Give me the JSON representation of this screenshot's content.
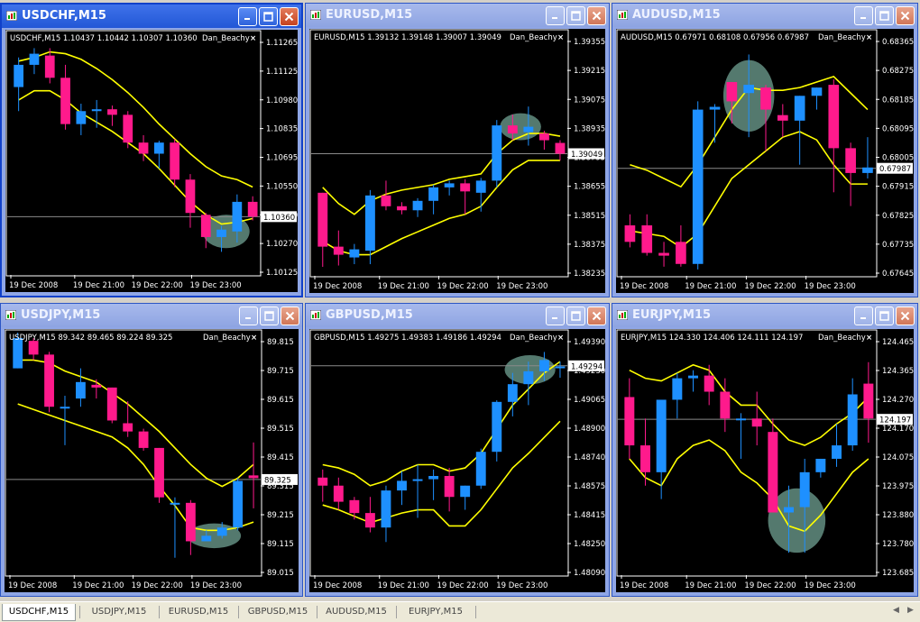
{
  "windows": [
    {
      "title": "USDCHF,M15",
      "active": true,
      "info": "USDCHF,M15  1.10437 1.10442 1.10307 1.10360",
      "ymin": 1.1005,
      "ymax": 1.1135,
      "yticks": [
        "1.11265",
        "1.11125",
        "1.10980",
        "1.10835",
        "1.10695",
        "1.10550",
        "1.10410",
        "1.10270",
        "1.10125"
      ],
      "price": 1.1036,
      "price_label": "1.10360",
      "xlabels": [
        "19 Dec 2008",
        "19 Dec 21:00",
        "19 Dec 22:00",
        "19 Dec 23:00"
      ],
      "candles": [
        [
          1.1106,
          1.1122,
          1.1093,
          1.1118
        ],
        [
          1.1118,
          1.1127,
          1.1113,
          1.1124
        ],
        [
          1.1123,
          1.1127,
          1.1108,
          1.1111
        ],
        [
          1.1111,
          1.1118,
          1.1083,
          1.1086
        ],
        [
          1.1086,
          1.1097,
          1.108,
          1.1093
        ],
        [
          1.1093,
          1.1099,
          1.1084,
          1.1094
        ],
        [
          1.1094,
          1.1096,
          1.1085,
          1.1091
        ],
        [
          1.1091,
          1.1093,
          1.1073,
          1.1076
        ],
        [
          1.1076,
          1.108,
          1.1066,
          1.107
        ],
        [
          1.107,
          1.1077,
          1.1062,
          1.1076
        ],
        [
          1.1076,
          1.1078,
          1.1052,
          1.1056
        ],
        [
          1.1056,
          1.1059,
          1.103,
          1.1038
        ],
        [
          1.1037,
          1.1038,
          1.1019,
          1.1025
        ],
        [
          1.1025,
          1.1031,
          1.1017,
          1.1029
        ],
        [
          1.1028,
          1.1048,
          1.1022,
          1.1044
        ],
        [
          1.1044,
          1.1047,
          1.1034,
          1.1036
        ]
      ],
      "bands": [
        [
          1.112,
          1.1122,
          1.1125,
          1.1124,
          1.1121,
          1.1116,
          1.111,
          1.1103,
          1.1095,
          1.1086,
          1.1078,
          1.107,
          1.1063,
          1.1058,
          1.1056,
          1.1052
        ],
        [
          1.1099,
          1.1104,
          1.1104,
          1.1099,
          1.1092,
          1.1087,
          1.1082,
          1.1076,
          1.107,
          1.1062,
          1.1053,
          1.1044,
          1.1037,
          1.1032,
          1.1033,
          1.1035
        ]
      ],
      "ellipse": [
        13.3,
        1.1028,
        1.5,
        0.0009
      ]
    },
    {
      "title": "EURUSD,M15",
      "active": false,
      "info": "EURUSD,M15  1.39132 1.39148 1.39007 1.39049",
      "ymin": 1.3815,
      "ymax": 1.3995,
      "yticks": [
        "1.39355",
        "1.39215",
        "1.39075",
        "1.38935",
        "1.38795",
        "1.38655",
        "1.38515",
        "1.38375",
        "1.38235"
      ],
      "price": 1.3905,
      "price_label": "1.39049",
      "xlabels": [
        "19 Dec 2008",
        "19 Dec 21:00",
        "19 Dec 22:00",
        "19 Dec 23:00"
      ],
      "candles": [
        [
          1.3876,
          1.3876,
          1.3821,
          1.3836
        ],
        [
          1.3836,
          1.3848,
          1.3822,
          1.383
        ],
        [
          1.3828,
          1.3838,
          1.3823,
          1.3834
        ],
        [
          1.3833,
          1.3878,
          1.3823,
          1.3874
        ],
        [
          1.3874,
          1.3885,
          1.3863,
          1.3866
        ],
        [
          1.3866,
          1.3869,
          1.386,
          1.3863
        ],
        [
          1.3863,
          1.3872,
          1.3858,
          1.387
        ],
        [
          1.387,
          1.3882,
          1.386,
          1.388
        ],
        [
          1.388,
          1.3885,
          1.3874,
          1.3883
        ],
        [
          1.3883,
          1.3886,
          1.386,
          1.3877
        ],
        [
          1.3876,
          1.3887,
          1.3862,
          1.3885
        ],
        [
          1.3885,
          1.393,
          1.388,
          1.3926
        ],
        [
          1.3926,
          1.3934,
          1.3915,
          1.392
        ],
        [
          1.3921,
          1.394,
          1.3911,
          1.3925
        ],
        [
          1.392,
          1.3922,
          1.3908,
          1.3915
        ],
        [
          1.3913,
          1.3915,
          1.39,
          1.3905
        ]
      ],
      "bands": [
        [
          1.388,
          1.3868,
          1.386,
          1.387,
          1.3875,
          1.3878,
          1.388,
          1.3882,
          1.3886,
          1.3888,
          1.389,
          1.3905,
          1.3915,
          1.392,
          1.392,
          1.3918
        ],
        [
          1.384,
          1.3833,
          1.383,
          1.383,
          1.3836,
          1.3842,
          1.3847,
          1.3852,
          1.3857,
          1.386,
          1.3866,
          1.388,
          1.3893,
          1.39,
          1.39,
          1.39
        ]
      ],
      "ellipse": [
        12.5,
        1.3925,
        1.3,
        0.001
      ]
    },
    {
      "title": "AUDUSD,M15",
      "active": false,
      "info": "AUDUSD,M15  0.67971 0.68108 0.67956 0.67987",
      "ymin": 0.676,
      "ymax": 0.6848,
      "yticks": [
        "0.68365",
        "0.68275",
        "0.68185",
        "0.68095",
        "0.68005",
        "0.67915",
        "0.67825",
        "0.67735",
        "0.67645"
      ],
      "price": 0.67987,
      "price_label": "0.67987",
      "xlabels": [
        "19 Dec 2008",
        "19 Dec 21:00",
        "19 Dec 22:00",
        "19 Dec 23:00"
      ],
      "candles": [
        [
          0.6778,
          0.6782,
          0.677,
          0.6772
        ],
        [
          0.6778,
          0.6782,
          0.6767,
          0.6768
        ],
        [
          0.6768,
          0.6772,
          0.6763,
          0.6767
        ],
        [
          0.6772,
          0.6778,
          0.6763,
          0.6764
        ],
        [
          0.6764,
          0.6823,
          0.6762,
          0.682
        ],
        [
          0.682,
          0.6822,
          0.6808,
          0.6821
        ],
        [
          0.683,
          0.683,
          0.6815,
          0.6823
        ],
        [
          0.6826,
          0.684,
          0.681,
          0.6829
        ],
        [
          0.6828,
          0.6829,
          0.6805,
          0.682
        ],
        [
          0.6818,
          0.6822,
          0.681,
          0.6816
        ],
        [
          0.6816,
          0.6825,
          0.68,
          0.6825
        ],
        [
          0.6825,
          0.6828,
          0.682,
          0.6828
        ],
        [
          0.6829,
          0.6831,
          0.679,
          0.6806
        ],
        [
          0.6806,
          0.6808,
          0.6785,
          0.6797
        ],
        [
          0.6797,
          0.681,
          0.6795,
          0.6799
        ]
      ],
      "bands": [
        [
          0.68,
          0.6798,
          0.6795,
          0.6792,
          0.68,
          0.681,
          0.682,
          0.6828,
          0.6827,
          0.6827,
          0.6828,
          0.683,
          0.6832,
          0.6826,
          0.682
        ],
        [
          0.6776,
          0.6775,
          0.6774,
          0.677,
          0.6775,
          0.6785,
          0.6795,
          0.68,
          0.6805,
          0.681,
          0.6812,
          0.6809,
          0.68,
          0.6793,
          0.6793
        ]
      ],
      "ellipse": [
        7.0,
        0.6825,
        1.5,
        0.0013
      ]
    },
    {
      "title": "USDJPY,M15",
      "active": false,
      "info": "USDJPY,M15  89.342 89.465 89.224 89.325",
      "ymin": 88.98,
      "ymax": 89.86,
      "yticks": [
        "89.815",
        "89.715",
        "89.615",
        "89.515",
        "89.415",
        "89.315",
        "89.215",
        "89.115",
        "89.015"
      ],
      "price": 89.325,
      "price_label": "89.325",
      "xlabels": [
        "19 Dec 2008",
        "19 Dec 21:00",
        "19 Dec 22:00",
        "19 Dec 23:00"
      ],
      "candles": [
        [
          89.73,
          89.86,
          89.73,
          89.84
        ],
        [
          89.83,
          89.84,
          89.76,
          89.78
        ],
        [
          89.78,
          89.79,
          89.57,
          89.59
        ],
        [
          89.59,
          89.63,
          89.45,
          89.59
        ],
        [
          89.62,
          89.73,
          89.59,
          89.68
        ],
        [
          89.67,
          89.69,
          89.62,
          89.66
        ],
        [
          89.66,
          89.66,
          89.53,
          89.54
        ],
        [
          89.53,
          89.61,
          89.48,
          89.5
        ],
        [
          89.5,
          89.51,
          89.43,
          89.44
        ],
        [
          89.44,
          89.44,
          89.24,
          89.26
        ],
        [
          89.24,
          89.26,
          89.04,
          89.24
        ],
        [
          89.24,
          89.25,
          89.05,
          89.1
        ],
        [
          89.1,
          89.14,
          89.1,
          89.12
        ],
        [
          89.12,
          89.17,
          89.11,
          89.15
        ],
        [
          89.15,
          89.33,
          89.14,
          89.32
        ],
        [
          89.34,
          89.46,
          89.22,
          89.33
        ]
      ],
      "bands": [
        [
          89.76,
          89.76,
          89.75,
          89.72,
          89.7,
          89.68,
          89.64,
          89.6,
          89.55,
          89.5,
          89.44,
          89.38,
          89.33,
          89.3,
          89.33,
          89.38
        ],
        [
          89.6,
          89.58,
          89.56,
          89.54,
          89.52,
          89.5,
          89.48,
          89.44,
          89.38,
          89.3,
          89.23,
          89.15,
          89.14,
          89.14,
          89.15,
          89.17
        ]
      ],
      "ellipse": [
        12.5,
        89.12,
        1.7,
        0.045
      ]
    },
    {
      "title": "GBPUSD,M15",
      "active": false,
      "info": "GBPUSD,M15  1.49275 1.49383 1.49186 1.49294",
      "ymin": 1.48,
      "ymax": 1.495,
      "yticks": [
        "1.49390",
        "1.49230",
        "1.49065",
        "1.48900",
        "1.48740",
        "1.48575",
        "1.48415",
        "1.48250",
        "1.48090"
      ],
      "price": 1.49294,
      "price_label": "1.49294",
      "xlabels": [
        "19 Dec 2008",
        "19 Dec 21:00",
        "19 Dec 22:00",
        "19 Dec 23:00"
      ],
      "candles": [
        [
          1.486,
          1.4865,
          1.4845,
          1.4855
        ],
        [
          1.4855,
          1.486,
          1.484,
          1.4845
        ],
        [
          1.4846,
          1.4848,
          1.4834,
          1.4838
        ],
        [
          1.4838,
          1.4848,
          1.4826,
          1.4829
        ],
        [
          1.4829,
          1.4855,
          1.482,
          1.4852
        ],
        [
          1.4852,
          1.4864,
          1.4843,
          1.4858
        ],
        [
          1.4858,
          1.4868,
          1.4835,
          1.4859
        ],
        [
          1.4859,
          1.4865,
          1.4846,
          1.4861
        ],
        [
          1.4861,
          1.4866,
          1.4839,
          1.4848
        ],
        [
          1.4848,
          1.4855,
          1.484,
          1.4855
        ],
        [
          1.4855,
          1.4878,
          1.4853,
          1.4876
        ],
        [
          1.4876,
          1.4908,
          1.487,
          1.4907
        ],
        [
          1.4907,
          1.4925,
          1.4898,
          1.4918
        ],
        [
          1.4918,
          1.4932,
          1.4905,
          1.4926
        ],
        [
          1.4926,
          1.4938,
          1.492,
          1.4933
        ],
        [
          1.4928,
          1.4932,
          1.4922,
          1.4929
        ]
      ],
      "bands": [
        [
          1.4868,
          1.4866,
          1.4862,
          1.4855,
          1.4858,
          1.4864,
          1.4868,
          1.4868,
          1.4864,
          1.4866,
          1.4875,
          1.489,
          1.4905,
          1.4915,
          1.4925,
          1.4932
        ],
        [
          1.4843,
          1.484,
          1.4836,
          1.4832,
          1.4835,
          1.4838,
          1.484,
          1.484,
          1.483,
          1.483,
          1.484,
          1.4853,
          1.4866,
          1.4875,
          1.4885,
          1.4895
        ]
      ],
      "ellipse": [
        13.1,
        1.4927,
        1.6,
        0.0009
      ]
    },
    {
      "title": "EURJPY,M15",
      "active": false,
      "info": "EURJPY,M15  124.330 124.406 124.111 124.197",
      "ymin": 123.62,
      "ymax": 124.52,
      "yticks": [
        "124.465",
        "124.365",
        "124.270",
        "124.170",
        "124.075",
        "123.975",
        "123.880",
        "123.780",
        "123.685"
      ],
      "price": 124.197,
      "price_label": "124.197",
      "xlabels": [
        "19 Dec 2008",
        "19 Dec 21:00",
        "19 Dec 22:00",
        "19 Dec 23:00"
      ],
      "candles": [
        [
          124.28,
          124.35,
          124.05,
          124.1
        ],
        [
          124.1,
          124.2,
          123.95,
          124.0
        ],
        [
          124.0,
          124.2,
          123.9,
          124.27
        ],
        [
          124.27,
          124.37,
          124.2,
          124.35
        ],
        [
          124.35,
          124.38,
          124.3,
          124.36
        ],
        [
          124.36,
          124.4,
          124.25,
          124.3
        ],
        [
          124.3,
          124.35,
          124.15,
          124.2
        ],
        [
          124.2,
          124.22,
          124.05,
          124.2
        ],
        [
          124.2,
          124.3,
          124.1,
          124.17
        ],
        [
          124.15,
          124.2,
          123.85,
          123.85
        ],
        [
          123.85,
          123.95,
          123.7,
          123.87
        ],
        [
          123.87,
          124.05,
          123.7,
          124.0
        ],
        [
          124.0,
          124.05,
          123.98,
          124.05
        ],
        [
          124.05,
          124.18,
          124.02,
          124.1
        ],
        [
          124.1,
          124.35,
          124.08,
          124.29
        ],
        [
          124.33,
          124.41,
          124.11,
          124.2
        ]
      ],
      "bands": [
        [
          124.38,
          124.35,
          124.34,
          124.37,
          124.4,
          124.38,
          124.3,
          124.25,
          124.25,
          124.18,
          124.12,
          124.1,
          124.13,
          124.18,
          124.22,
          124.28
        ],
        [
          124.05,
          123.98,
          123.95,
          124.05,
          124.1,
          124.12,
          124.08,
          124.0,
          123.96,
          123.9,
          123.8,
          123.78,
          123.84,
          123.92,
          124.0,
          124.05
        ]
      ],
      "ellipse": [
        10.5,
        123.82,
        1.8,
        0.12
      ]
    }
  ],
  "owner_label": "Dan_Beachy",
  "close_x": "×",
  "tabs": [
    "USDCHF,M15",
    "USDJPY,M15",
    "EURUSD,M15",
    "GBPUSD,M15",
    "AUDUSD,M15",
    "EURJPY,M15"
  ],
  "colors": {
    "bull": "#1e90ff",
    "bear": "#ff1a8c",
    "band": "#ffff00",
    "grid": "#8a8a8a",
    "ellipse": "#8ccab8"
  }
}
